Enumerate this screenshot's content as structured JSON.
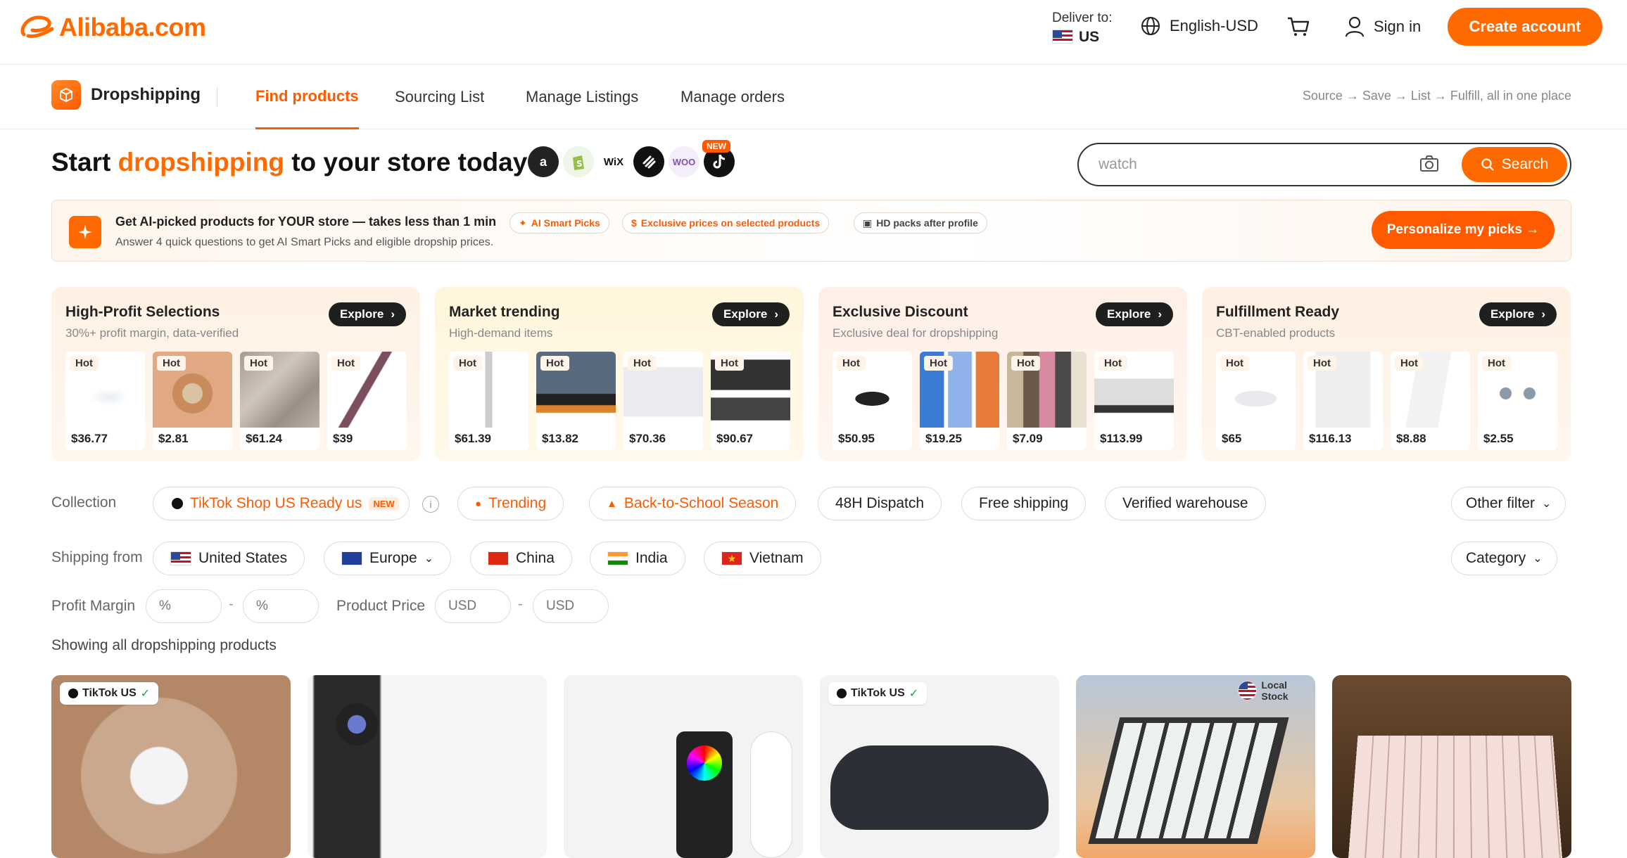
{
  "header": {
    "logo_text": "Alibaba.com",
    "deliver_label": "Deliver to:",
    "deliver_value": "US",
    "language": "English-USD",
    "signin": "Sign in",
    "create_account": "Create account"
  },
  "nav": {
    "brand": "Dropshipping",
    "tabs": [
      {
        "label": "Find products",
        "active": true
      },
      {
        "label": "Sourcing List",
        "active": false
      },
      {
        "label": "Manage Listings",
        "active": false
      },
      {
        "label": "Manage orders",
        "active": false
      }
    ],
    "tagline": "Source → Save → List → Fulfill, all in one place"
  },
  "hero": {
    "title_pre": "Start ",
    "title_hl": "dropshipping",
    "title_post": " to your store today",
    "platforms": [
      "amazon-icon",
      "shopify-icon",
      "wix-icon",
      "squarespace-icon",
      "woo-icon",
      "tiktok-icon"
    ],
    "new_badge": "NEW"
  },
  "search": {
    "value": "watch",
    "button": "Search"
  },
  "ai_banner": {
    "title": "Get AI-picked products for YOUR store — takes less than 1 min",
    "subtitle": "Answer 4 quick questions to get AI Smart Picks and eligible dropship prices.",
    "chips": [
      "AI Smart Picks",
      "Exclusive prices on selected products",
      "HD packs after profile"
    ],
    "cta": "Personalize my picks →"
  },
  "collections": [
    {
      "title": "High-Profit Selections",
      "subtitle": "30%+ profit margin, data-verified",
      "explore": "Explore",
      "items": [
        {
          "hot": "Hot",
          "price": "$36.77"
        },
        {
          "hot": "Hot",
          "price": "$2.81"
        },
        {
          "hot": "Hot",
          "price": "$61.24"
        },
        {
          "hot": "Hot",
          "price": "$39"
        }
      ]
    },
    {
      "title": "Market trending",
      "subtitle": "High-demand items",
      "explore": "Explore",
      "items": [
        {
          "hot": "Hot",
          "price": "$61.39"
        },
        {
          "hot": "Hot",
          "price": "$13.82"
        },
        {
          "hot": "Hot",
          "price": "$70.36"
        },
        {
          "hot": "Hot",
          "price": "$90.67"
        }
      ]
    },
    {
      "title": "Exclusive Discount",
      "subtitle": "Exclusive deal for dropshipping",
      "explore": "Explore",
      "items": [
        {
          "hot": "Hot",
          "price": "$50.95"
        },
        {
          "hot": "Hot",
          "price": "$19.25"
        },
        {
          "hot": "Hot",
          "price": "$7.09"
        },
        {
          "hot": "Hot",
          "price": "$113.99"
        }
      ]
    },
    {
      "title": "Fulfillment Ready",
      "subtitle": "CBT-enabled products",
      "explore": "Explore",
      "items": [
        {
          "hot": "Hot",
          "price": "$65"
        },
        {
          "hot": "Hot",
          "price": "$116.13"
        },
        {
          "hot": "Hot",
          "price": "$8.88"
        },
        {
          "hot": "Hot",
          "price": "$2.55"
        }
      ]
    }
  ],
  "filters": {
    "collection_label": "Collection",
    "collection_chips": [
      "TikTok Shop US Ready us",
      "Trending",
      "Back-to-School Season",
      "48H Dispatch",
      "Free shipping",
      "Verified warehouse"
    ],
    "tiktok_new": "NEW",
    "other_filter": "Other filter",
    "shipping_label": "Shipping from",
    "shipping_chips": [
      "United States",
      "Europe",
      "China",
      "India",
      "Vietnam"
    ],
    "category": "Category",
    "profit_label": "Profit Margin",
    "profit_placeholder": "%",
    "price_label": "Product Price",
    "price_placeholder": "USD",
    "dash": "-",
    "showing": "Showing all dropshipping products"
  },
  "products": [
    {
      "badge": "TikTok US"
    },
    {
      "badge": ""
    },
    {
      "badge": ""
    },
    {
      "badge": "TikTok US"
    },
    {
      "badge": "Local Stock"
    },
    {
      "badge": ""
    }
  ],
  "colors": {
    "accent": "#ff6a00",
    "dark": "#1f1f1f"
  }
}
